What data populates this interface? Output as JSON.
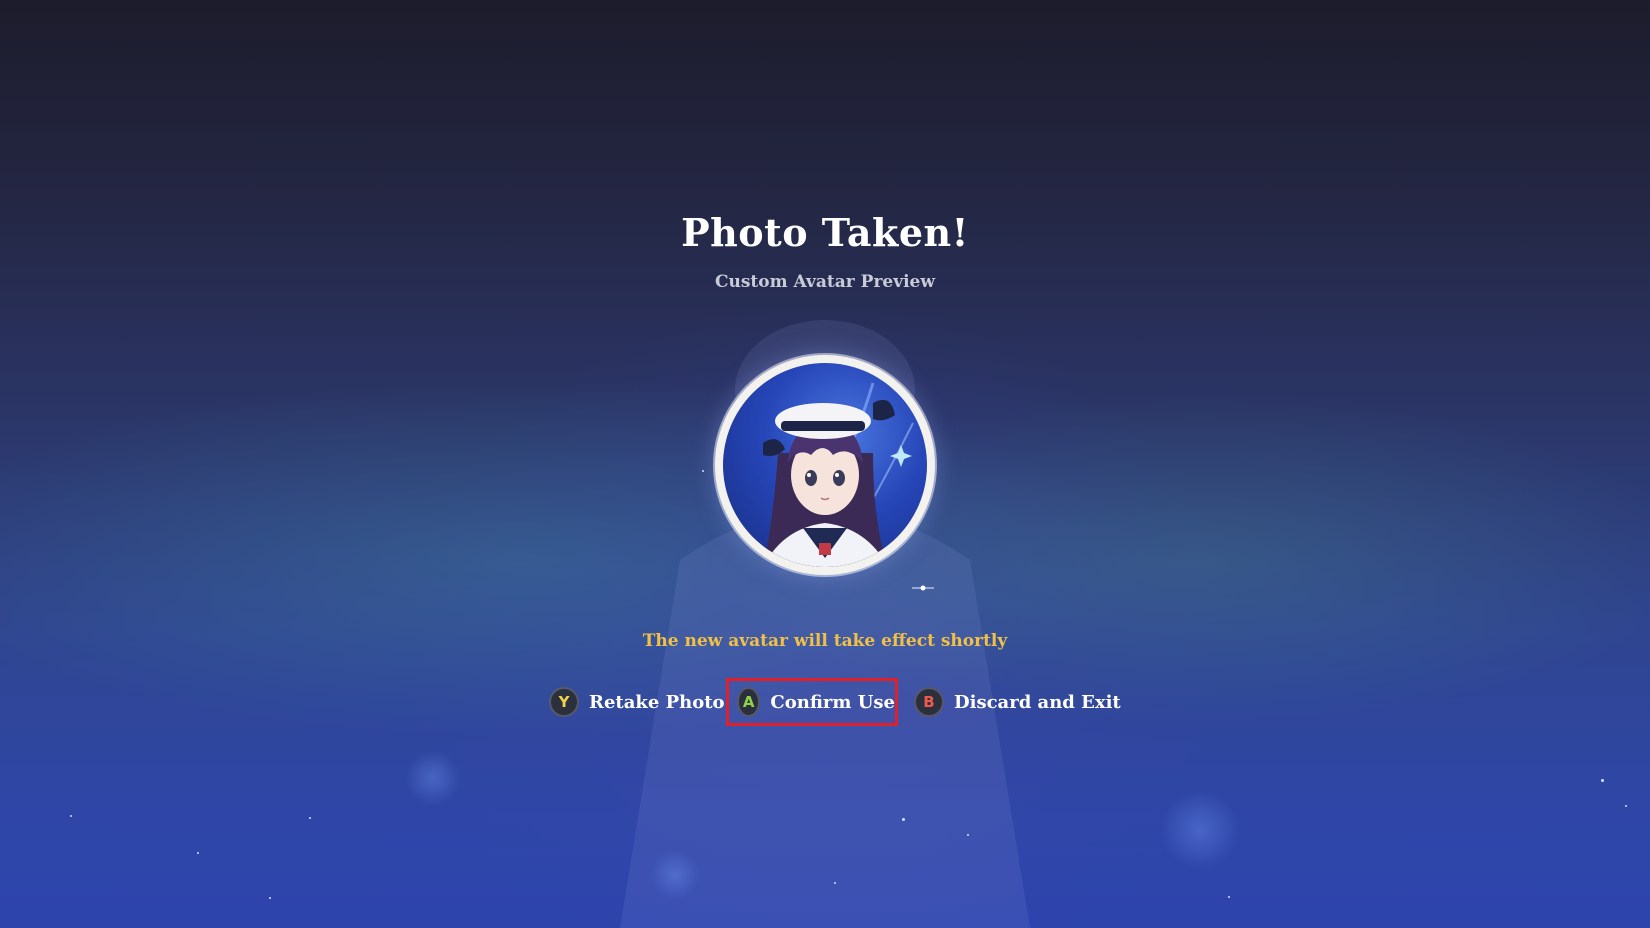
{
  "screen": {
    "title": "Photo Taken!",
    "subtitle": "Custom Avatar Preview",
    "notice": "The new avatar will take effect shortly"
  },
  "actions": [
    {
      "key": "Y",
      "label": "Retake Photo",
      "key_color": "#f2d24a"
    },
    {
      "key": "A",
      "label": "Confirm Use",
      "key_color": "#8fd34a",
      "highlighted": true
    },
    {
      "key": "B",
      "label": "Discard and Exit",
      "key_color": "#ee5b4e"
    }
  ],
  "colors": {
    "notice": "#f0c146",
    "highlight_border": "#e0202a",
    "background_top": "#1d1c2c",
    "background_bottom": "#2d44ad"
  },
  "icons": {
    "avatar": "character-portrait-icon",
    "sparkle": "sparkle-icon"
  }
}
